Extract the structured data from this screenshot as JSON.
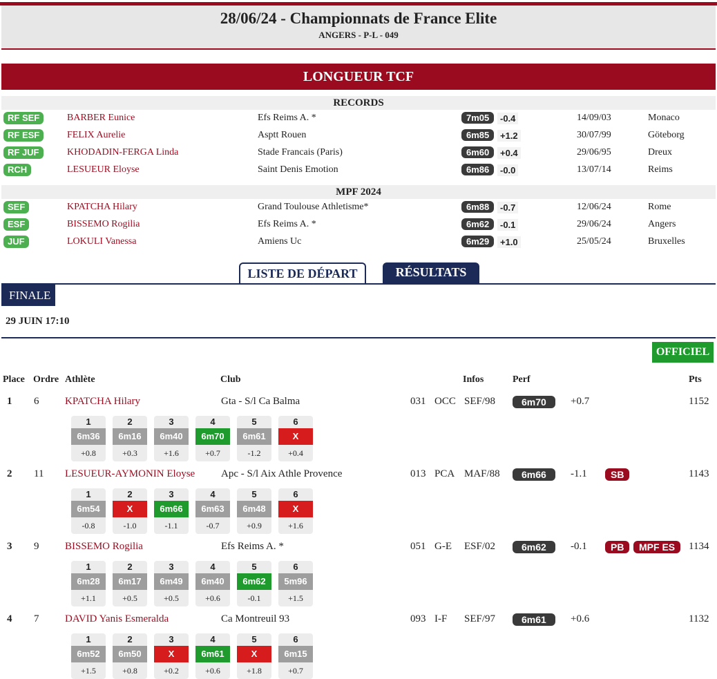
{
  "header": {
    "title": "28/06/24 - Championnats de France Elite",
    "subtitle": "ANGERS - P-L - 049"
  },
  "event": "LONGUEUR TCF",
  "records": {
    "title": "RECORDS",
    "rows": [
      {
        "badge": "RF SEF",
        "name": "BARBER Eunice",
        "club": "Efs Reims A. *",
        "perf": "7m05",
        "wind": "-0.4",
        "date": "14/09/03",
        "place": "Monaco"
      },
      {
        "badge": "RF ESF",
        "name": "FELIX Aurelie",
        "club": "Asptt Rouen",
        "perf": "6m85",
        "wind": "+1.2",
        "date": "30/07/99",
        "place": "Göteborg"
      },
      {
        "badge": "RF JUF",
        "name": "KHODADIN-FERGA Linda",
        "club": "Stade Francais (Paris)",
        "perf": "6m60",
        "wind": "+0.4",
        "date": "29/06/95",
        "place": "Dreux"
      },
      {
        "badge": "RCH",
        "name": "LESUEUR Eloyse",
        "club": "Saint Denis Emotion",
        "perf": "6m86",
        "wind": "-0.0",
        "date": "13/07/14",
        "place": "Reims"
      }
    ]
  },
  "mpf": {
    "title": "MPF 2024",
    "rows": [
      {
        "badge": "SEF",
        "name": "KPATCHA Hilary",
        "club": "Grand Toulouse Athletisme*",
        "perf": "6m88",
        "wind": "-0.7",
        "date": "12/06/24",
        "place": "Rome"
      },
      {
        "badge": "ESF",
        "name": "BISSEMO Rogilia",
        "club": "Efs Reims A. *",
        "perf": "6m62",
        "wind": "-0.1",
        "date": "29/06/24",
        "place": "Angers"
      },
      {
        "badge": "JUF",
        "name": "LOKULI Vanessa",
        "club": "Amiens Uc",
        "perf": "6m29",
        "wind": "+1.0",
        "date": "25/05/24",
        "place": "Bruxelles"
      }
    ]
  },
  "tabs": {
    "start_list": "LISTE DE DÉPART",
    "results": "RÉSULTATS"
  },
  "round": "FINALE",
  "datetime": "29 JUIN 17:10",
  "status": "OFFICIEL",
  "columns": {
    "place": "Place",
    "order": "Ordre",
    "athlete": "Athlète",
    "club": "Club",
    "infos": "Infos",
    "perf": "Perf",
    "pts": "Pts"
  },
  "results": [
    {
      "place": "1",
      "order": "6",
      "name": "KPATCHA Hilary",
      "club": "Gta - S/l Ca Balma",
      "dept": "031",
      "league": "OCC",
      "cat": "SEF/98",
      "perf": "6m70",
      "wind": "+0.7",
      "tags": [],
      "pts": "1152",
      "attempts": [
        {
          "n": "1",
          "v": "6m36",
          "w": "+0.8",
          "s": "g"
        },
        {
          "n": "2",
          "v": "6m16",
          "w": "+0.3",
          "s": "g"
        },
        {
          "n": "3",
          "v": "6m40",
          "w": "+1.6",
          "s": "g"
        },
        {
          "n": "4",
          "v": "6m70",
          "w": "+0.7",
          "s": "best"
        },
        {
          "n": "5",
          "v": "6m61",
          "w": "-1.2",
          "s": "g"
        },
        {
          "n": "6",
          "v": "X",
          "w": "+0.4",
          "s": "x"
        }
      ]
    },
    {
      "place": "2",
      "order": "11",
      "name": "LESUEUR-AYMONIN Eloyse",
      "club": "Apc - S/l Aix Athle Provence",
      "dept": "013",
      "league": "PCA",
      "cat": "MAF/88",
      "perf": "6m66",
      "wind": "-1.1",
      "tags": [
        "SB"
      ],
      "pts": "1143",
      "attempts": [
        {
          "n": "1",
          "v": "6m54",
          "w": "-0.8",
          "s": "g"
        },
        {
          "n": "2",
          "v": "X",
          "w": "-1.0",
          "s": "x"
        },
        {
          "n": "3",
          "v": "6m66",
          "w": "-1.1",
          "s": "best"
        },
        {
          "n": "4",
          "v": "6m63",
          "w": "-0.7",
          "s": "g"
        },
        {
          "n": "5",
          "v": "6m48",
          "w": "+0.9",
          "s": "g"
        },
        {
          "n": "6",
          "v": "X",
          "w": "+1.6",
          "s": "x"
        }
      ]
    },
    {
      "place": "3",
      "order": "9",
      "name": "BISSEMO Rogilia",
      "club": "Efs Reims A. *",
      "dept": "051",
      "league": "G-E",
      "cat": "ESF/02",
      "perf": "6m62",
      "wind": "-0.1",
      "tags": [
        "PB",
        "MPF ES"
      ],
      "pts": "1134",
      "attempts": [
        {
          "n": "1",
          "v": "6m28",
          "w": "+1.1",
          "s": "g"
        },
        {
          "n": "2",
          "v": "6m17",
          "w": "+0.5",
          "s": "g"
        },
        {
          "n": "3",
          "v": "6m49",
          "w": "+0.5",
          "s": "g"
        },
        {
          "n": "4",
          "v": "6m40",
          "w": "+0.6",
          "s": "g"
        },
        {
          "n": "5",
          "v": "6m62",
          "w": "-0.1",
          "s": "best"
        },
        {
          "n": "6",
          "v": "5m96",
          "w": "+1.5",
          "s": "g"
        }
      ]
    },
    {
      "place": "4",
      "order": "7",
      "name": "DAVID Yanis Esmeralda",
      "club": "Ca Montreuil 93",
      "dept": "093",
      "league": "I-F",
      "cat": "SEF/97",
      "perf": "6m61",
      "wind": "+0.6",
      "tags": [],
      "pts": "1132",
      "attempts": [
        {
          "n": "1",
          "v": "6m52",
          "w": "+1.5",
          "s": "g"
        },
        {
          "n": "2",
          "v": "6m50",
          "w": "+0.8",
          "s": "g"
        },
        {
          "n": "3",
          "v": "X",
          "w": "+0.2",
          "s": "x"
        },
        {
          "n": "4",
          "v": "6m61",
          "w": "+0.6",
          "s": "best"
        },
        {
          "n": "5",
          "v": "X",
          "w": "+1.8",
          "s": "x"
        },
        {
          "n": "6",
          "v": "6m15",
          "w": "+0.7",
          "s": "g"
        }
      ]
    }
  ]
}
